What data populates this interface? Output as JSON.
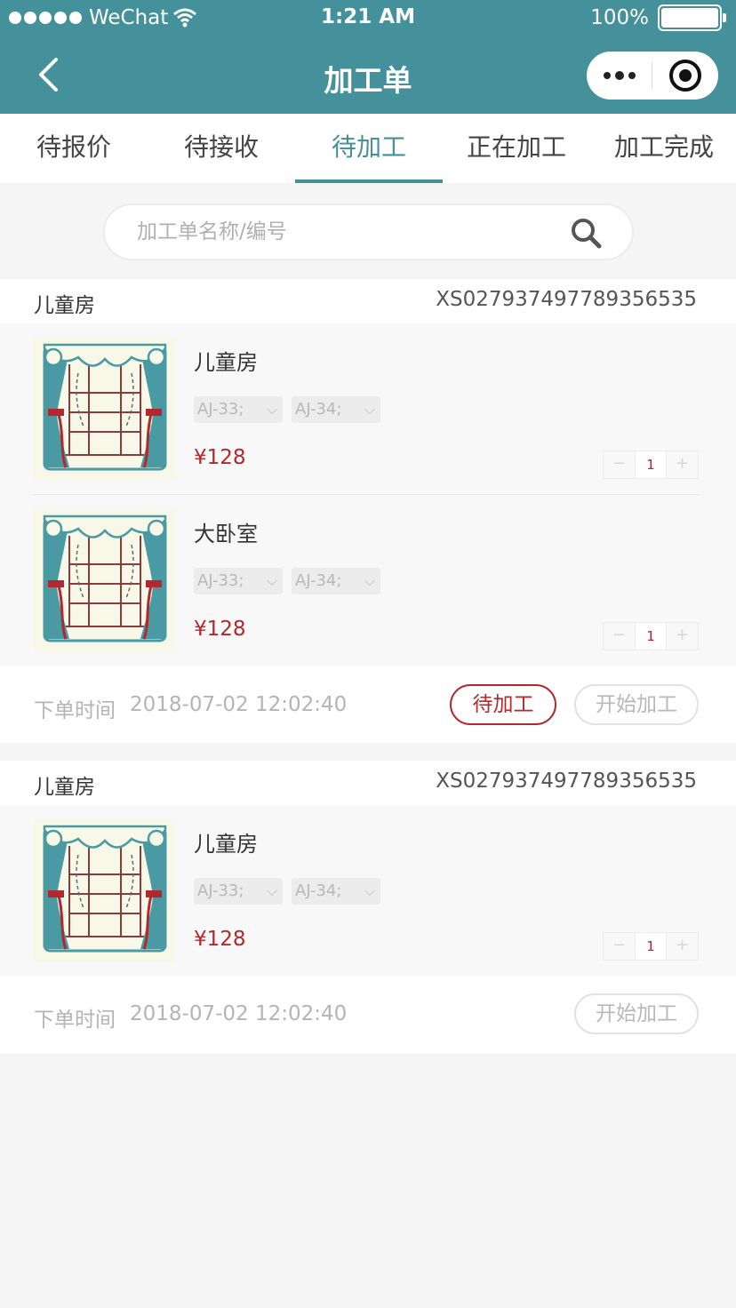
{
  "status_bar": {
    "carrier": "WeChat",
    "time": "1:21 AM",
    "battery": "100%",
    "battery_level": 1.0
  },
  "nav": {
    "title": "加工单"
  },
  "tabs": [
    {
      "label": "待报价"
    },
    {
      "label": "待接收"
    },
    {
      "label": "待加工",
      "active": true
    },
    {
      "label": "正在加工"
    },
    {
      "label": "加工完成"
    }
  ],
  "search": {
    "placeholder": "加工单名称/编号",
    "value": ""
  },
  "orders": [
    {
      "name": "儿童房",
      "number": "XS027937497789356535",
      "items": [
        {
          "name": "儿童房",
          "specs": [
            "AJ-33;",
            "AJ-34;"
          ],
          "price": "¥128",
          "qty": "1",
          "minus": "−",
          "plus": "+"
        },
        {
          "name": "大卧室",
          "specs": [
            "AJ-33;",
            "AJ-34;"
          ],
          "price": "¥128",
          "qty": "1",
          "minus": "−",
          "plus": "+"
        }
      ],
      "time_label": "下单时间",
      "time": "2018-07-02 12:02:40",
      "status": "待加工",
      "action": "开始加工"
    },
    {
      "name": "儿童房",
      "number": "XS027937497789356535",
      "items": [
        {
          "name": "儿童房",
          "specs": [
            "AJ-33;",
            "AJ-34;"
          ],
          "price": "¥128",
          "qty": "1",
          "minus": "−",
          "plus": "+"
        }
      ],
      "time_label": "下单时间",
      "time": "2018-07-02 12:02:40",
      "action": "开始加工"
    }
  ],
  "colors": {
    "brand": "#44919b",
    "price": "#b1282e",
    "background": "#f5f5f5"
  }
}
